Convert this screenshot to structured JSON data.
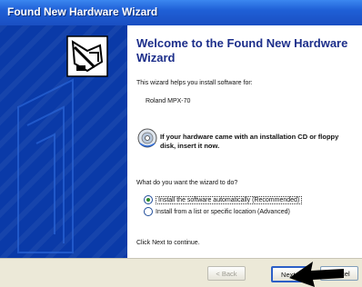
{
  "window": {
    "title": "Found New Hardware Wizard"
  },
  "content": {
    "heading": "Welcome to the Found New Hardware Wizard",
    "intro": "This wizard helps you install software for:",
    "device": "Roland MPX-70",
    "cd_prompt": "If your hardware came with an installation CD or floppy disk, insert it now.",
    "question": "What do you want the wizard to do?",
    "options": [
      {
        "label": "Install the software automatically (Recommended)",
        "selected": true
      },
      {
        "label": "Install from a list or specific location (Advanced)",
        "selected": false
      }
    ],
    "next_hint": "Click Next to continue."
  },
  "buttons": {
    "back": "< Back",
    "next": "Next >",
    "cancel": "Cancel"
  },
  "icons": {
    "wizard": "hardware-install-icon",
    "cd": "cd-icon",
    "arrow": "arrow-pointer"
  },
  "colors": {
    "sidebar": "#0a3aa8",
    "heading": "#1c2e8a",
    "titlebar": "#1f5fd6"
  }
}
